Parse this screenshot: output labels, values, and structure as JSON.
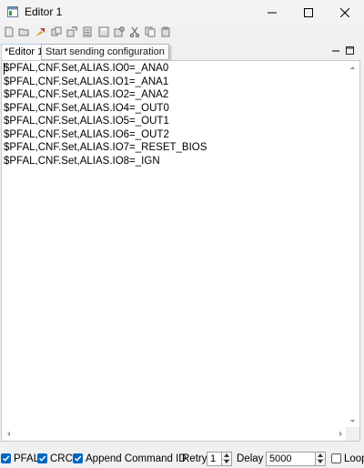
{
  "window": {
    "title": "Editor 1"
  },
  "tabs": [
    {
      "label": "*Editor 1"
    }
  ],
  "tooltip": {
    "text": "Start sending configuration"
  },
  "editor": {
    "lines": [
      "$PFAL,CNF.Set,ALIAS.IO0=_ANA0",
      "$PFAL,CNF.Set,ALIAS.IO1=_ANA1",
      "$PFAL,CNF.Set,ALIAS.IO2=_ANA2",
      "$PFAL,CNF.Set,ALIAS.IO4=_OUT0",
      "$PFAL,CNF.Set,ALIAS.IO5=_OUT1",
      "$PFAL,CNF.Set,ALIAS.IO6=_OUT2",
      "$PFAL,CNF.Set,ALIAS.IO7=_RESET_BIOS",
      "$PFAL,CNF.Set,ALIAS.IO8=_IGN"
    ]
  },
  "toolbar": {
    "icons": [
      "new-icon",
      "open-icon",
      "send-icon",
      "copy-config-icon",
      "export-icon",
      "list-icon",
      "save-icon",
      "settings-icon",
      "cut-icon",
      "copy-icon",
      "paste-icon"
    ]
  },
  "status": {
    "pfal_label": "PFAL",
    "pfal_checked": true,
    "crc_label": "CRC",
    "crc_checked": true,
    "append_label": "Append Command ID",
    "append_checked": true,
    "retry_label": "Retry",
    "retry_value": "1",
    "delay_label": "Delay",
    "delay_value": "5000",
    "loop_label": "Loop",
    "loop_checked": false
  },
  "colors": {
    "accent": "#0067c0",
    "tab_border": "#b8cde8"
  }
}
